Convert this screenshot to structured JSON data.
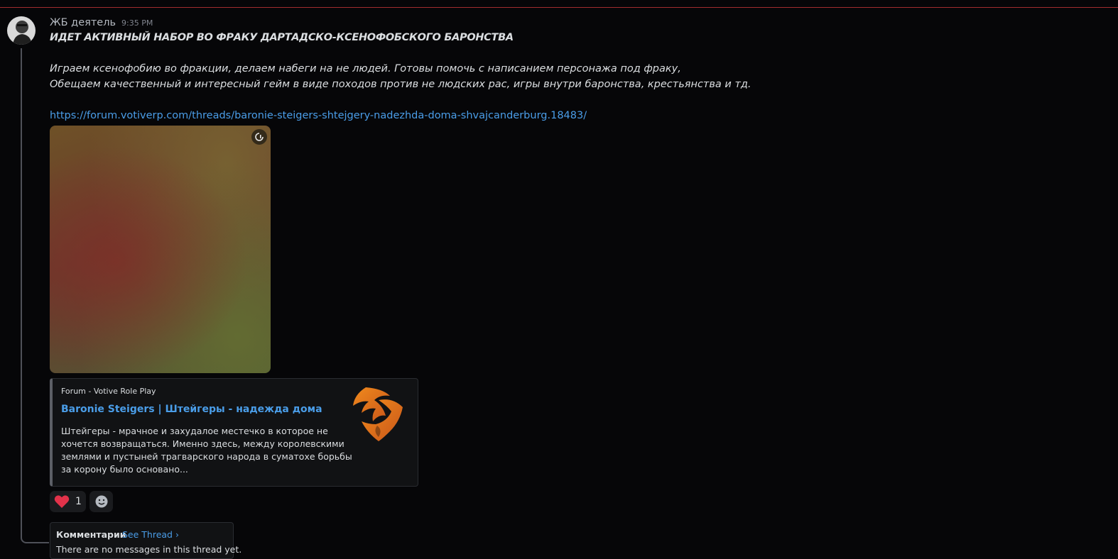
{
  "message": {
    "author": "ЖБ деятель",
    "timestamp": "9:35 PM",
    "headline": "ИДЕТ АКТИВНЫЙ НАБОР ВО ФРАКУ ДАРТАДСКО-КСЕНОФОБСКОГО БАРОНСТВА",
    "body_lines": [
      "Играем ксенофобию во фракции, делаем набеги на не людей. Готовы помочь с написанием персонажа под фраку,",
      "Обещаем качественный и интересный гейм в виде походов против не людских рас, игры внутри баронства, крестьянства и тд."
    ],
    "link": "https://forum.votiverp.com/threads/baronie-steigers-shtejgery-nadezhda-doma-shvajcanderburg.18483/"
  },
  "embed": {
    "provider": "Forum - Votive Role Play",
    "title": "Baronie Steigers | Штейгеры  - надежда дома Шв...",
    "description_lines": [
      "Штейгеры - мрачное и захудалое местечко в которое не",
      "хочется возвращаться. Именно здесь, между королевскими",
      "землями и пустыней трагварского народа в суматохе борьбы",
      "за корону было основано..."
    ],
    "thumbnail_icon": "eagle-shield-logo",
    "accent_color": "#e07a1f"
  },
  "reactions": [
    {
      "icon": "heart-icon",
      "count": "1"
    }
  ],
  "thread": {
    "name": "Комментарии",
    "see_thread": "See Thread ›",
    "empty_text": "There are no messages in this thread yet."
  },
  "colors": {
    "link": "#4a9de8",
    "divider": "#a12d2f",
    "background": "#060608"
  }
}
